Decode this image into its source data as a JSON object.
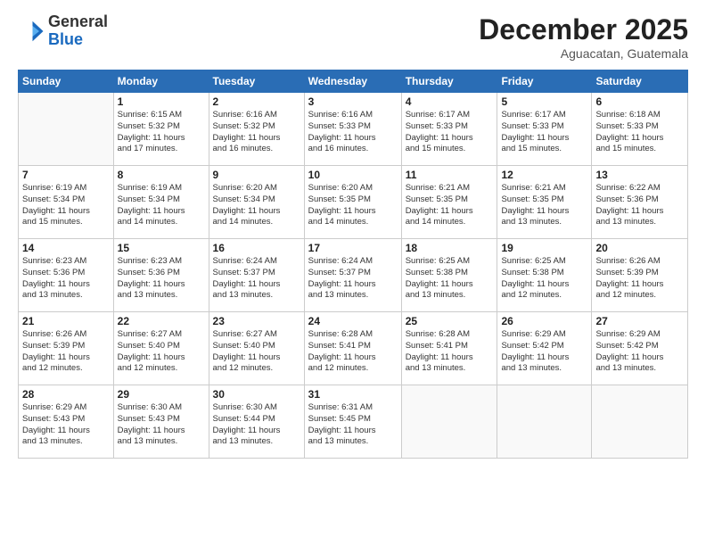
{
  "logo": {
    "general": "General",
    "blue": "Blue"
  },
  "header": {
    "month": "December 2025",
    "location": "Aguacatan, Guatemala"
  },
  "days_of_week": [
    "Sunday",
    "Monday",
    "Tuesday",
    "Wednesday",
    "Thursday",
    "Friday",
    "Saturday"
  ],
  "weeks": [
    [
      {
        "day": "",
        "info": ""
      },
      {
        "day": "1",
        "info": "Sunrise: 6:15 AM\nSunset: 5:32 PM\nDaylight: 11 hours\nand 17 minutes."
      },
      {
        "day": "2",
        "info": "Sunrise: 6:16 AM\nSunset: 5:32 PM\nDaylight: 11 hours\nand 16 minutes."
      },
      {
        "day": "3",
        "info": "Sunrise: 6:16 AM\nSunset: 5:33 PM\nDaylight: 11 hours\nand 16 minutes."
      },
      {
        "day": "4",
        "info": "Sunrise: 6:17 AM\nSunset: 5:33 PM\nDaylight: 11 hours\nand 15 minutes."
      },
      {
        "day": "5",
        "info": "Sunrise: 6:17 AM\nSunset: 5:33 PM\nDaylight: 11 hours\nand 15 minutes."
      },
      {
        "day": "6",
        "info": "Sunrise: 6:18 AM\nSunset: 5:33 PM\nDaylight: 11 hours\nand 15 minutes."
      }
    ],
    [
      {
        "day": "7",
        "info": "Sunrise: 6:19 AM\nSunset: 5:34 PM\nDaylight: 11 hours\nand 15 minutes."
      },
      {
        "day": "8",
        "info": "Sunrise: 6:19 AM\nSunset: 5:34 PM\nDaylight: 11 hours\nand 14 minutes."
      },
      {
        "day": "9",
        "info": "Sunrise: 6:20 AM\nSunset: 5:34 PM\nDaylight: 11 hours\nand 14 minutes."
      },
      {
        "day": "10",
        "info": "Sunrise: 6:20 AM\nSunset: 5:35 PM\nDaylight: 11 hours\nand 14 minutes."
      },
      {
        "day": "11",
        "info": "Sunrise: 6:21 AM\nSunset: 5:35 PM\nDaylight: 11 hours\nand 14 minutes."
      },
      {
        "day": "12",
        "info": "Sunrise: 6:21 AM\nSunset: 5:35 PM\nDaylight: 11 hours\nand 13 minutes."
      },
      {
        "day": "13",
        "info": "Sunrise: 6:22 AM\nSunset: 5:36 PM\nDaylight: 11 hours\nand 13 minutes."
      }
    ],
    [
      {
        "day": "14",
        "info": "Sunrise: 6:23 AM\nSunset: 5:36 PM\nDaylight: 11 hours\nand 13 minutes."
      },
      {
        "day": "15",
        "info": "Sunrise: 6:23 AM\nSunset: 5:36 PM\nDaylight: 11 hours\nand 13 minutes."
      },
      {
        "day": "16",
        "info": "Sunrise: 6:24 AM\nSunset: 5:37 PM\nDaylight: 11 hours\nand 13 minutes."
      },
      {
        "day": "17",
        "info": "Sunrise: 6:24 AM\nSunset: 5:37 PM\nDaylight: 11 hours\nand 13 minutes."
      },
      {
        "day": "18",
        "info": "Sunrise: 6:25 AM\nSunset: 5:38 PM\nDaylight: 11 hours\nand 13 minutes."
      },
      {
        "day": "19",
        "info": "Sunrise: 6:25 AM\nSunset: 5:38 PM\nDaylight: 11 hours\nand 12 minutes."
      },
      {
        "day": "20",
        "info": "Sunrise: 6:26 AM\nSunset: 5:39 PM\nDaylight: 11 hours\nand 12 minutes."
      }
    ],
    [
      {
        "day": "21",
        "info": "Sunrise: 6:26 AM\nSunset: 5:39 PM\nDaylight: 11 hours\nand 12 minutes."
      },
      {
        "day": "22",
        "info": "Sunrise: 6:27 AM\nSunset: 5:40 PM\nDaylight: 11 hours\nand 12 minutes."
      },
      {
        "day": "23",
        "info": "Sunrise: 6:27 AM\nSunset: 5:40 PM\nDaylight: 11 hours\nand 12 minutes."
      },
      {
        "day": "24",
        "info": "Sunrise: 6:28 AM\nSunset: 5:41 PM\nDaylight: 11 hours\nand 12 minutes."
      },
      {
        "day": "25",
        "info": "Sunrise: 6:28 AM\nSunset: 5:41 PM\nDaylight: 11 hours\nand 13 minutes."
      },
      {
        "day": "26",
        "info": "Sunrise: 6:29 AM\nSunset: 5:42 PM\nDaylight: 11 hours\nand 13 minutes."
      },
      {
        "day": "27",
        "info": "Sunrise: 6:29 AM\nSunset: 5:42 PM\nDaylight: 11 hours\nand 13 minutes."
      }
    ],
    [
      {
        "day": "28",
        "info": "Sunrise: 6:29 AM\nSunset: 5:43 PM\nDaylight: 11 hours\nand 13 minutes."
      },
      {
        "day": "29",
        "info": "Sunrise: 6:30 AM\nSunset: 5:43 PM\nDaylight: 11 hours\nand 13 minutes."
      },
      {
        "day": "30",
        "info": "Sunrise: 6:30 AM\nSunset: 5:44 PM\nDaylight: 11 hours\nand 13 minutes."
      },
      {
        "day": "31",
        "info": "Sunrise: 6:31 AM\nSunset: 5:45 PM\nDaylight: 11 hours\nand 13 minutes."
      },
      {
        "day": "",
        "info": ""
      },
      {
        "day": "",
        "info": ""
      },
      {
        "day": "",
        "info": ""
      }
    ]
  ]
}
